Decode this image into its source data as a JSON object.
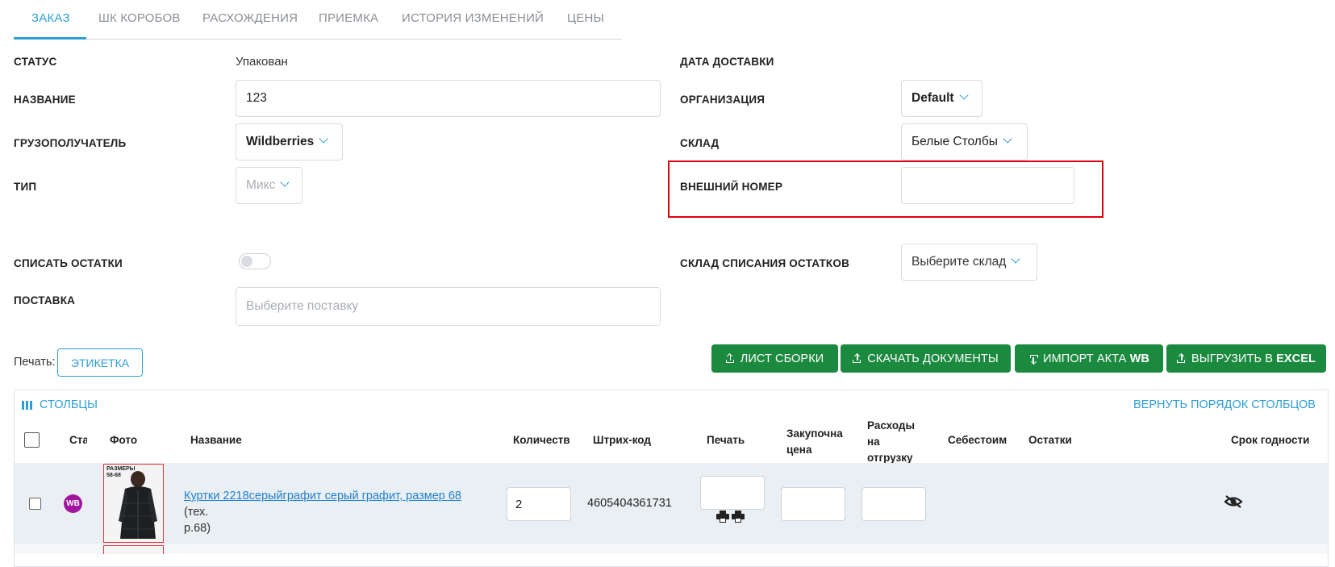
{
  "tabs": [
    "ЗАКАЗ",
    "ШК КОРОБОВ",
    "РАСХОЖДЕНИЯ",
    "ПРИЕМКА",
    "ИСТОРИЯ ИЗМЕНЕНИЙ",
    "ЦЕНЫ"
  ],
  "form": {
    "status_label": "СТАТУС",
    "status_value": "Упакован",
    "name_label": "НАЗВАНИЕ",
    "name_value": "123",
    "consignee_label": "ГРУЗОПОЛУЧАТЕЛЬ",
    "consignee_value": "Wildberries",
    "type_label": "ТИП",
    "type_placeholder": "Микс",
    "writeoff_label": "СПИСАТЬ ОСТАТКИ",
    "supply_label": "ПОСТАВКА",
    "supply_placeholder": "Выберите поставку",
    "delivery_date_label": "ДАТА ДОСТАВКИ",
    "org_label": "ОРГАНИЗАЦИЯ",
    "org_value": "Default",
    "warehouse_label": "СКЛАД",
    "warehouse_value": "Белые Столбы",
    "external_number_label": "ВНЕШНИЙ НОМЕР",
    "external_number_value": "",
    "writeoff_warehouse_label": "СКЛАД СПИСАНИЯ ОСТАТКОВ",
    "writeoff_warehouse_placeholder": "Выберите склад"
  },
  "print": {
    "label": "Печать:",
    "label_button": "ЭТИКЕТКА"
  },
  "actions": {
    "assembly_sheet": "ЛИСТ СБОРКИ",
    "download_docs": "СКАЧАТЬ ДОКУМЕНТЫ",
    "import_act_prefix": "ИМПОРТ АКТА",
    "import_act_suffix": "WB",
    "export_prefix": "ВЫГРУЗИТЬ В",
    "export_suffix": "EXCEL"
  },
  "table": {
    "columns_button": "СТОЛБЦЫ",
    "reset_columns": "ВЕРНУТЬ ПОРЯДОК СТОЛБЦОВ",
    "headers": {
      "status": "Ста",
      "photo": "Фото",
      "name": "Название",
      "qty": "Количеств",
      "barcode": "Штрих-код",
      "print": "Печать",
      "purchase_1": "Закупочна",
      "purchase_2": "цена",
      "ship_1": "Расходы",
      "ship_2": "на",
      "ship_3": "отгрузку",
      "cost": "Себестоим",
      "stock": "Остатки",
      "expiry": "Срок годности"
    },
    "rows": [
      {
        "badge": "WB",
        "photo_caption_1": "РАЗМЕРЫ",
        "photo_caption_2": "58-68",
        "name_link": "Куртки 2218серыйграфит серый графит, размер 68",
        "name_suffix_1": " (тех.",
        "name_suffix_2": "р.68)",
        "qty": "2",
        "barcode": "4605404361731"
      }
    ]
  },
  "colors": {
    "accent": "#2e9ed6",
    "green": "#1b8a3f",
    "highlight": "#e3000f",
    "wb_badge": "#a1159e"
  }
}
